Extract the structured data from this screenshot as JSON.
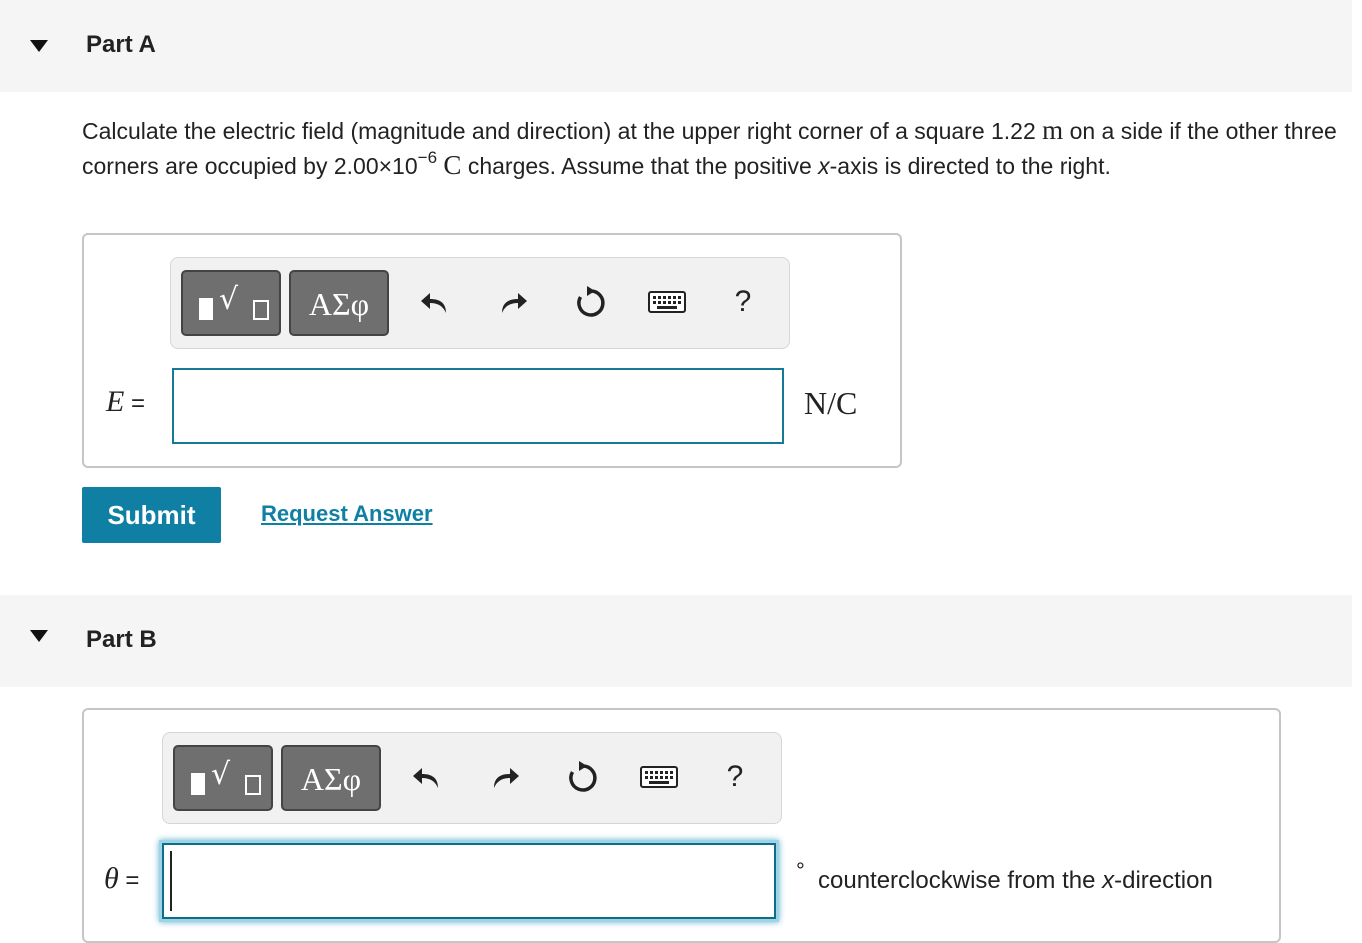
{
  "partA": {
    "title": "Part A",
    "prompt": {
      "t1": "Calculate the electric field (magnitude and direction) at the upper right corner of a square 1.22 ",
      "unit_m": "m",
      "t2": " on a side if the other three corners are occupied by 2.00×10",
      "exp": "−6",
      "t3": " ",
      "unit_C": "C",
      "t4": " charges. Assume that the positive ",
      "x": "x",
      "t5": "-axis is directed to the right."
    },
    "toolbar": {
      "greek_label": "ΑΣφ",
      "radical": "√",
      "help": "?"
    },
    "label_var": "E",
    "label_eq": " =",
    "unit": "N/C",
    "submit": "Submit",
    "request": "Request Answer"
  },
  "partB": {
    "title": "Part B",
    "toolbar": {
      "greek_label": "ΑΣφ",
      "radical": "√",
      "help": "?"
    },
    "label_var": "θ",
    "label_eq": " =",
    "unit_deg": "°",
    "unit_text1": "counterclockwise from the ",
    "unit_x": "x",
    "unit_text2": "-direction"
  }
}
